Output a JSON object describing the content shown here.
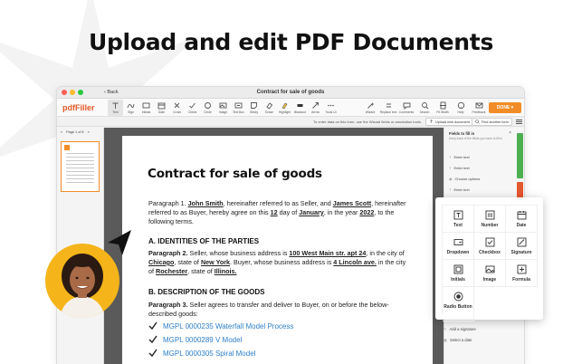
{
  "headline": "Upload and edit PDF Documents",
  "window": {
    "title": "Contract for sale of goods",
    "back_label": "Back",
    "traffic_colors": [
      "#fd5f57",
      "#febc2e",
      "#28c840"
    ]
  },
  "toolbar": {
    "logo": "pdfFiller",
    "tools": [
      {
        "label": "Text",
        "icon": "text-icon"
      },
      {
        "label": "Sign",
        "icon": "sign-icon"
      },
      {
        "label": "Initials",
        "icon": "initials-icon"
      },
      {
        "label": "Date",
        "icon": "date-icon"
      },
      {
        "label": "Cross",
        "icon": "cross-icon"
      },
      {
        "label": "Check",
        "icon": "check-icon"
      },
      {
        "label": "Circle",
        "icon": "circle-icon"
      },
      {
        "label": "Image",
        "icon": "image-icon"
      },
      {
        "label": "Text Box",
        "icon": "text-box-icon"
      },
      {
        "label": "Sticky",
        "icon": "sticky-icon"
      },
      {
        "label": "Erase",
        "icon": "erase-icon"
      },
      {
        "label": "Highlight",
        "icon": "highlight-icon"
      },
      {
        "label": "Blackout",
        "icon": "blackout-icon"
      },
      {
        "label": "Arrow",
        "icon": "arrow-icon"
      },
      {
        "label": "Tools UI",
        "icon": "more-icon"
      }
    ],
    "right_tools": [
      {
        "label": "Wizard",
        "icon": "wizard-icon"
      },
      {
        "label": "Replace text",
        "icon": "replace-text-icon"
      },
      {
        "label": "Comments",
        "icon": "comments-icon"
      },
      {
        "label": "Search",
        "icon": "search-icon"
      },
      {
        "label": "Fit Width",
        "icon": "fit-width-icon"
      },
      {
        "label": "Help",
        "icon": "help-icon"
      },
      {
        "label": "Feedback",
        "icon": "feedback-icon"
      }
    ],
    "done_label": "DONE",
    "accent": "#f28c28"
  },
  "subbar": {
    "hint": "To enter data on this form, use the Wizard fields or annotation tools.",
    "upload_label": "Upload new document",
    "find_label": "Find another form"
  },
  "thumbs": {
    "page_label": "Page 1 of 8"
  },
  "document": {
    "title": "Contract for sale of goods",
    "p1": {
      "a": "Paragraph 1. ",
      "seller": "John Smith",
      "b": ", hereinafter referred to as Seller, and ",
      "buyer": "James Scott",
      "c": ", hereinafter referred to as Buyer, hereby agree on this ",
      "day": "12",
      "d": " day of ",
      "month": "January",
      "e": ", in the year ",
      "year": "2022",
      "f": ", to the following terms."
    },
    "section_a": "A. IDENTITIES OF THE PARTIES",
    "p2": {
      "lead": "Paragraph 2.",
      "a": " Seller, whose business address is ",
      "seller_addr": "100 West Main str. apt 24",
      "b": ", in the city of ",
      "seller_city": "Chicago",
      "c": ", state of ",
      "seller_state": "New York",
      "d": ". Buyer, whose business address is ",
      "buyer_addr": "4 Lincoln ave.",
      "e": " in the city of ",
      "buyer_city": "Rochester",
      "f": ", state of ",
      "buyer_state": "Illinois."
    },
    "section_b": "B. DESCRIPTION OF THE GOODS",
    "p3": {
      "lead": "Paragraph 3.",
      "text": " Seller agrees to transfer and deliver to Buyer, on or before the below-described goods:"
    },
    "goods": [
      "MGPL 0000235 Waterfall Model Process",
      "MGPL 0000289 V Model",
      "MGPL 0000305 Spiral Model"
    ],
    "link_color": "#2f80c9"
  },
  "fields_panel": {
    "title": "Fields to fill in",
    "subtitle": "Keep track of the fields you have to fill in",
    "items": [
      {
        "label": "Enter text",
        "icon": "text-field-icon"
      },
      {
        "label": "Enter text",
        "icon": "text-field-icon"
      },
      {
        "label": "Choose options",
        "icon": "options-icon"
      },
      {
        "label": "Enter text",
        "icon": "text-field-icon"
      }
    ],
    "bottom_items": [
      {
        "label": "Add a signature",
        "icon": "signature-field-icon"
      },
      {
        "label": "Select a date",
        "icon": "date-field-icon"
      }
    ]
  },
  "field_picker": [
    {
      "label": "Text",
      "icon": "text-field-type-icon"
    },
    {
      "label": "Number",
      "icon": "number-field-type-icon"
    },
    {
      "label": "Date",
      "icon": "date-field-type-icon"
    },
    {
      "label": "Dropdown",
      "icon": "dropdown-field-type-icon"
    },
    {
      "label": "Checkbox",
      "icon": "checkbox-field-type-icon"
    },
    {
      "label": "Signature",
      "icon": "signature-field-type-icon"
    },
    {
      "label": "Initials",
      "icon": "initials-field-type-icon"
    },
    {
      "label": "Image",
      "icon": "image-field-type-icon"
    },
    {
      "label": "Formula",
      "icon": "formula-field-type-icon"
    },
    {
      "label": "Radio Button",
      "icon": "radio-button-field-type-icon"
    }
  ]
}
